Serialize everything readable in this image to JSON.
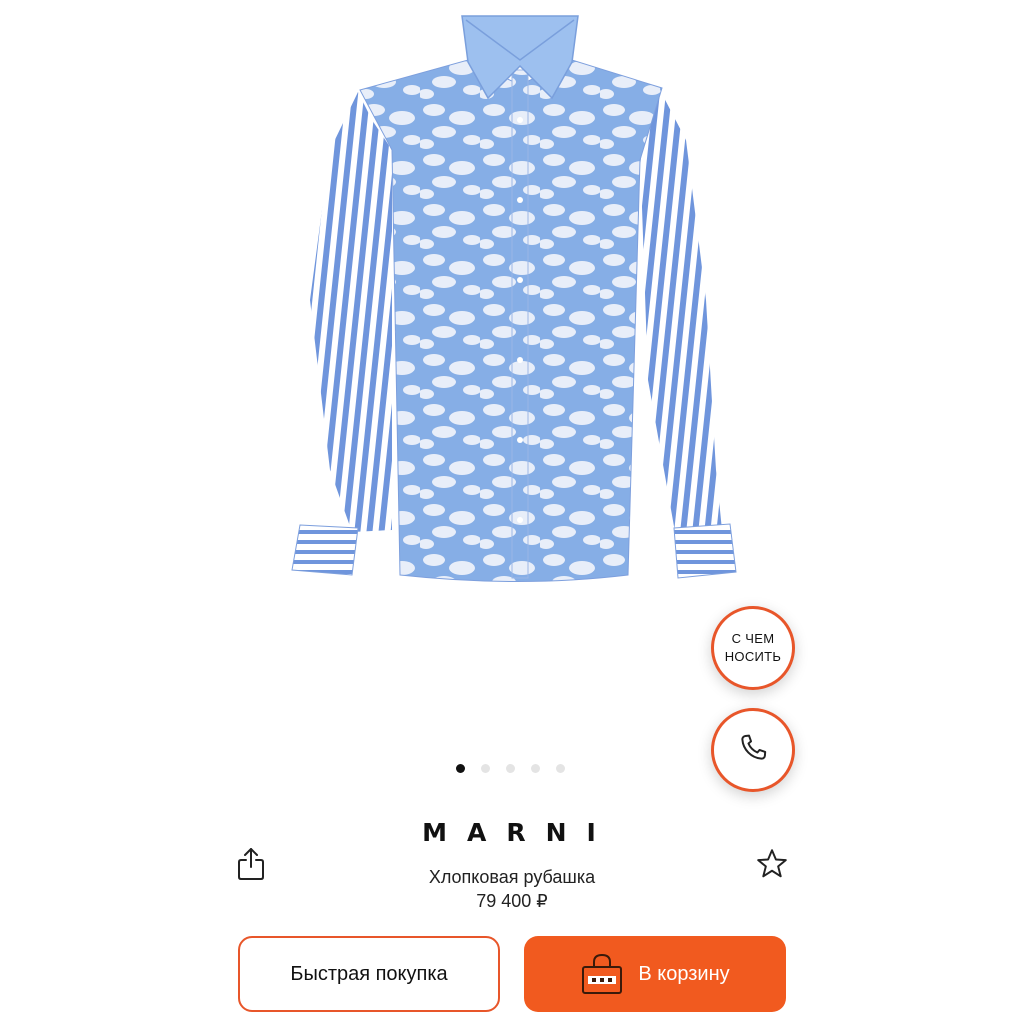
{
  "product": {
    "brand": "MARNI",
    "name": "Хлопковая рубашка",
    "price": "79 400 ₽",
    "image_icon": "shirt-photo"
  },
  "floating": {
    "outfit_label": "С ЧЕМ НОСИТЬ",
    "call_icon": "phone-icon"
  },
  "gallery": {
    "dots_total": 5,
    "active_index": 0
  },
  "actions": {
    "quick_buy_label": "Быстрая покупка",
    "add_to_cart_label": "В корзину",
    "share_icon": "share-icon",
    "favorite_icon": "star-icon",
    "cart_icon": "bag-icon"
  },
  "colors": {
    "accent": "#f15a1f",
    "accent_border": "#e8562a",
    "shirt_blue": "#86aee6",
    "collar_blue": "#9dc0ef"
  }
}
